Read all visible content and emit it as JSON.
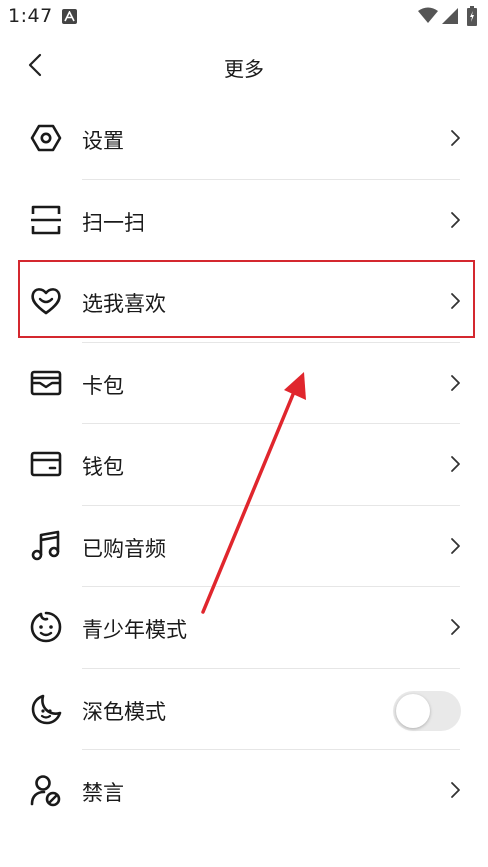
{
  "status_bar": {
    "time": "1:47",
    "notification_icon": "a-app-icon",
    "icons": [
      "wifi-icon",
      "signal-icon",
      "battery-charging-icon"
    ]
  },
  "nav": {
    "title": "更多",
    "back_icon": "chevron-left-icon"
  },
  "menu": [
    {
      "label": "设置",
      "icon": "settings-hexagon-icon",
      "trailing": "chevron"
    },
    {
      "label": "扫一扫",
      "icon": "scan-icon",
      "trailing": "chevron"
    },
    {
      "label": "选我喜欢",
      "icon": "heart-smile-icon",
      "trailing": "chevron",
      "highlighted": true
    },
    {
      "label": "卡包",
      "icon": "card-holder-icon",
      "trailing": "chevron"
    },
    {
      "label": "钱包",
      "icon": "wallet-icon",
      "trailing": "chevron"
    },
    {
      "label": "已购音频",
      "icon": "music-note-icon",
      "trailing": "chevron"
    },
    {
      "label": "青少年模式",
      "icon": "kid-face-icon",
      "trailing": "chevron"
    },
    {
      "label": "深色模式",
      "icon": "moon-icon",
      "trailing": "toggle",
      "toggle_on": false
    },
    {
      "label": "禁言",
      "icon": "user-mute-icon",
      "trailing": "chevron"
    }
  ],
  "annotation": {
    "highlight_color": "#d4282f",
    "arrow_color": "#e0262d"
  },
  "colors": {
    "text": "#1a1a1a",
    "divider": "#e6e6e6",
    "toggle_off_track": "#e9e9e9"
  }
}
